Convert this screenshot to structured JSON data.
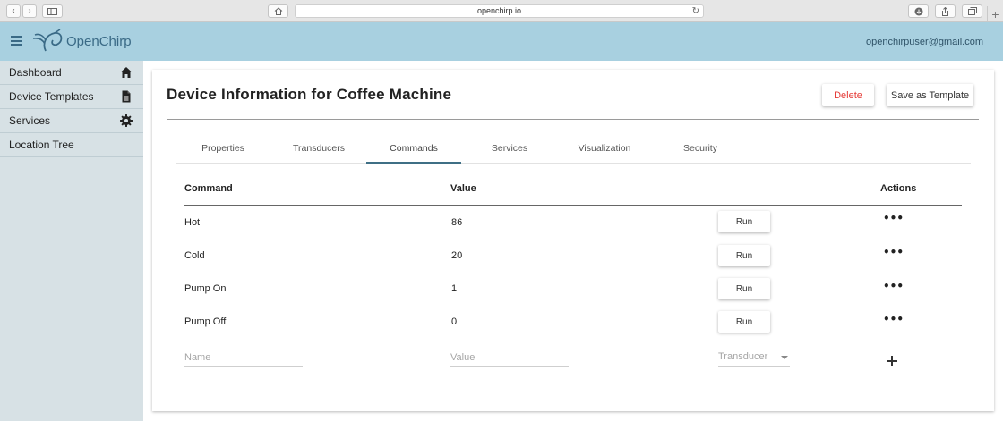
{
  "browser": {
    "url": "openchirp.io"
  },
  "header": {
    "brand": "OpenChirp",
    "user_email": "openchirpuser@gmail.com"
  },
  "sidebar": {
    "items": [
      {
        "label": "Dashboard",
        "icon": "home-icon"
      },
      {
        "label": "Device Templates",
        "icon": "document-icon"
      },
      {
        "label": "Services",
        "icon": "gear-icon"
      },
      {
        "label": "Location Tree",
        "icon": ""
      }
    ]
  },
  "page": {
    "title": "Device Information for Coffee Machine",
    "delete_label": "Delete",
    "save_template_label": "Save as Template"
  },
  "tabs": [
    "Properties",
    "Transducers",
    "Commands",
    "Services",
    "Visualization",
    "Security"
  ],
  "active_tab": "Commands",
  "table": {
    "headers": {
      "command": "Command",
      "value": "Value",
      "actions": "Actions"
    },
    "rows": [
      {
        "command": "Hot",
        "value": "86",
        "run_label": "Run"
      },
      {
        "command": "Cold",
        "value": "20",
        "run_label": "Run"
      },
      {
        "command": "Pump On",
        "value": "1",
        "run_label": "Run"
      },
      {
        "command": "Pump Off",
        "value": "0",
        "run_label": "Run"
      }
    ],
    "more_label": "•••"
  },
  "new_command": {
    "name_placeholder": "Name",
    "value_placeholder": "Value",
    "transducer_placeholder": "Transducer"
  },
  "colors": {
    "header_bg": "#a8d0e0",
    "sidebar_bg": "#d7e1e5",
    "accent": "#3f6f85",
    "delete": "#e53935"
  }
}
